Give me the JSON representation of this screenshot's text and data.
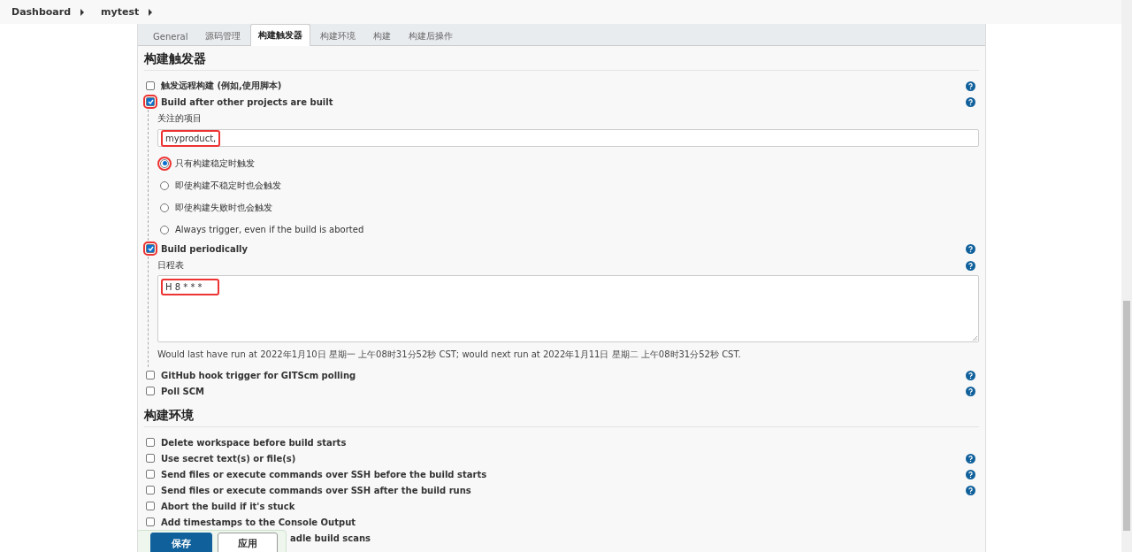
{
  "breadcrumb": [
    {
      "label": "Dashboard"
    },
    {
      "label": "mytest"
    }
  ],
  "tabs": [
    {
      "label": "General",
      "selected": false
    },
    {
      "label": "源码管理",
      "selected": false
    },
    {
      "label": "构建触发器",
      "selected": true
    },
    {
      "label": "构建环境",
      "selected": false
    },
    {
      "label": "构建",
      "selected": false
    },
    {
      "label": "构建后操作",
      "selected": false
    }
  ],
  "sections": [
    {
      "title": "构建触发器",
      "items": [
        {
          "kind": "checkbox",
          "label": "触发远程构建 (例如,使用脚本)",
          "checked": false,
          "help": true,
          "highlighted": false
        },
        {
          "kind": "checkbox",
          "label": "Build after other projects are built",
          "checked": true,
          "help": true,
          "highlighted": true,
          "children": [
            {
              "kind": "text-field",
              "label": "关注的项目",
              "value": "myproduct,",
              "highlighted": true
            },
            {
              "kind": "radio",
              "label": "只有构建稳定时触发",
              "selected": true,
              "highlighted": true
            },
            {
              "kind": "radio",
              "label": "即使构建不稳定时也会触发",
              "selected": false,
              "highlighted": false
            },
            {
              "kind": "radio",
              "label": "即使构建失败时也会触发",
              "selected": false,
              "highlighted": false
            },
            {
              "kind": "radio",
              "label": "Always trigger, even if the build is aborted",
              "selected": false,
              "highlighted": false
            }
          ]
        },
        {
          "kind": "checkbox",
          "label": "Build periodically",
          "checked": true,
          "help": true,
          "highlighted": true,
          "children": [
            {
              "kind": "textarea",
              "label": "日程表",
              "value": "H 8 * * *",
              "help": true,
              "highlighted": true
            },
            {
              "kind": "note",
              "text": "Would last have run at 2022年1月10日 星期一 上午08时31分52秒 CST; would next run at 2022年1月11日 星期二 上午08时31分52秒 CST."
            }
          ]
        },
        {
          "kind": "checkbox",
          "label": "GitHub hook trigger for GITScm polling",
          "checked": false,
          "help": true,
          "highlighted": false
        },
        {
          "kind": "checkbox",
          "label": "Poll SCM",
          "checked": false,
          "help": true,
          "highlighted": false
        }
      ]
    },
    {
      "title": "构建环境",
      "items": [
        {
          "kind": "checkbox",
          "label": "Delete workspace before build starts",
          "checked": false,
          "help": false,
          "highlighted": false
        },
        {
          "kind": "checkbox",
          "label": "Use secret text(s) or file(s)",
          "checked": false,
          "help": true,
          "highlighted": false
        },
        {
          "kind": "checkbox",
          "label": "Send files or execute commands over SSH before the build starts",
          "checked": false,
          "help": true,
          "highlighted": false
        },
        {
          "kind": "checkbox",
          "label": "Send files or execute commands over SSH after the build runs",
          "checked": false,
          "help": true,
          "highlighted": false
        },
        {
          "kind": "checkbox",
          "label": "Abort the build if it's stuck",
          "checked": false,
          "help": false,
          "highlighted": false
        },
        {
          "kind": "checkbox",
          "label": "Add timestamps to the Console Output",
          "checked": false,
          "help": false,
          "highlighted": false
        },
        {
          "kind": "covered-label",
          "label": "adle build scans"
        }
      ]
    }
  ],
  "save_bar": {
    "buttons": [
      {
        "label": "保存",
        "kind": "primary"
      },
      {
        "label": "应用",
        "kind": "secondary"
      }
    ]
  }
}
